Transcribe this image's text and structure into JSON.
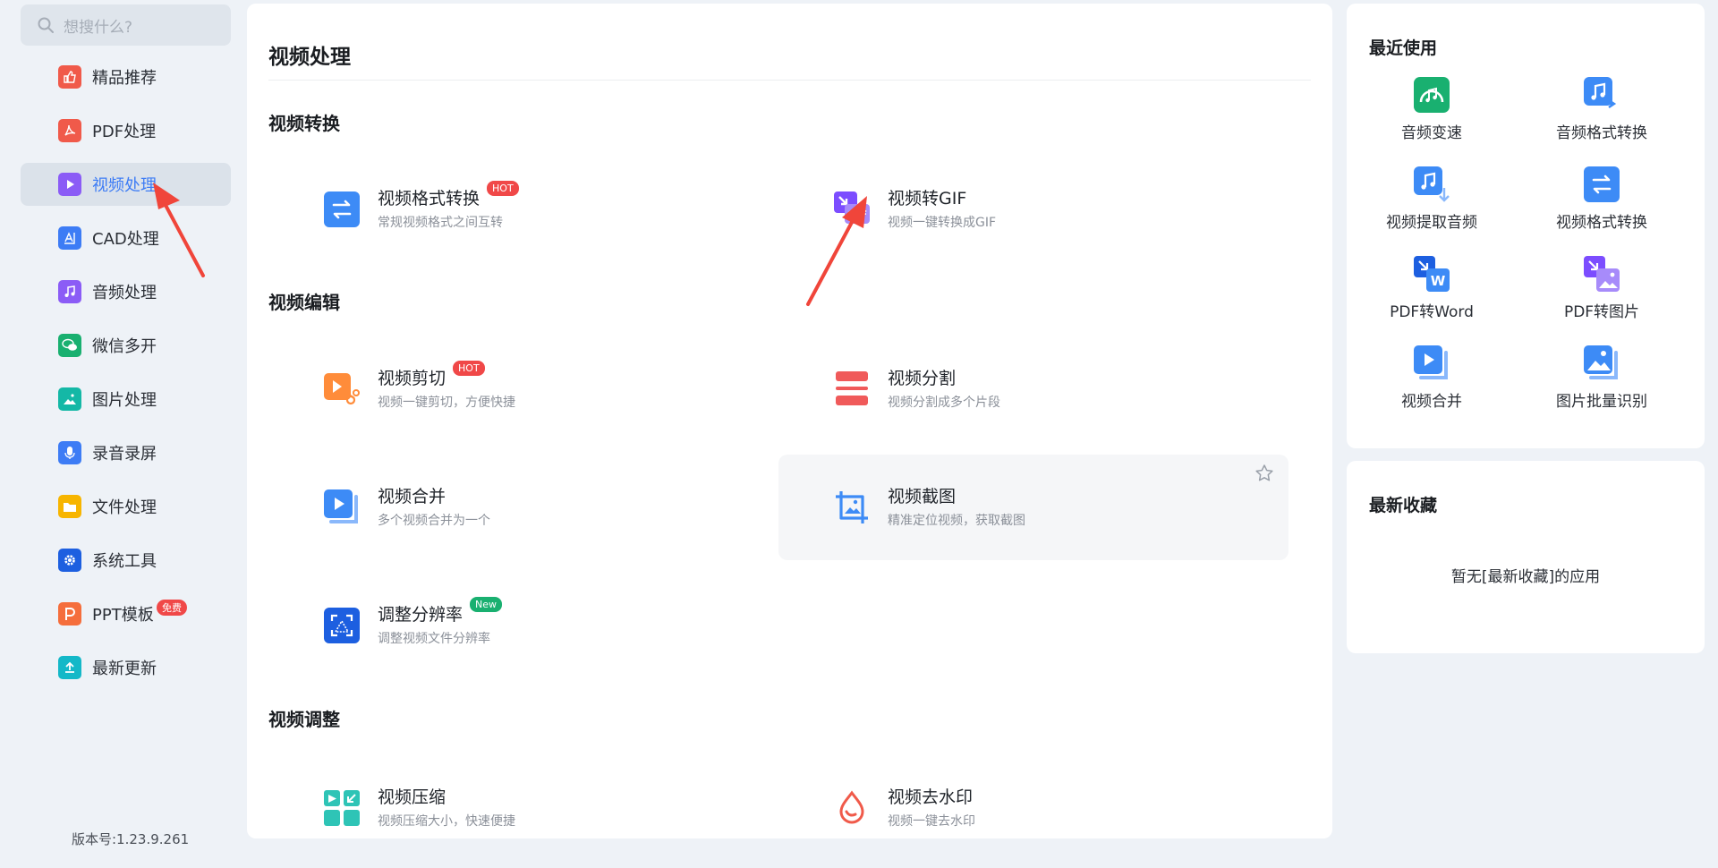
{
  "search": {
    "placeholder": "想搜什么?"
  },
  "sidebar": {
    "items": [
      {
        "label": "精品推荐",
        "icon": "thumbs-up-icon",
        "color": "#f05a4a"
      },
      {
        "label": "PDF处理",
        "icon": "pdf-icon",
        "color": "#f05a4a"
      },
      {
        "label": "视频处理",
        "icon": "video-play-icon",
        "color": "#8b5cf6",
        "active": true
      },
      {
        "label": "CAD处理",
        "icon": "cad-icon",
        "color": "#3d7cf5"
      },
      {
        "label": "音频处理",
        "icon": "music-note-icon",
        "color": "#8b5cf6"
      },
      {
        "label": "微信多开",
        "icon": "wechat-icon",
        "color": "#19b070"
      },
      {
        "label": "图片处理",
        "icon": "image-icon",
        "color": "#14b8a6"
      },
      {
        "label": "录音录屏",
        "icon": "microphone-icon",
        "color": "#3d7cf5"
      },
      {
        "label": "文件处理",
        "icon": "folder-icon",
        "color": "#f7b500"
      },
      {
        "label": "系统工具",
        "icon": "gear-icon",
        "color": "#1d5fe0"
      },
      {
        "label": "PPT模板",
        "icon": "ppt-icon",
        "color": "#f56e3c",
        "badge": "免费"
      },
      {
        "label": "最新更新",
        "icon": "upload-icon",
        "color": "#14b8c8"
      }
    ],
    "version": "版本号:1.23.9.261"
  },
  "main": {
    "title": "视频处理",
    "sections": {
      "convert": "视频转换",
      "edit": "视频编辑",
      "adjust": "视频调整"
    },
    "tools": {
      "format": {
        "name": "视频格式转换",
        "desc": "常规视频格式之间互转",
        "badge": "HOT"
      },
      "gif": {
        "name": "视频转GIF",
        "desc": "视频一键转换成GIF"
      },
      "cut": {
        "name": "视频剪切",
        "desc": "视频一键剪切，方便快捷",
        "badge": "HOT"
      },
      "split": {
        "name": "视频分割",
        "desc": "视频分割成多个片段"
      },
      "merge": {
        "name": "视频合并",
        "desc": "多个视频合并为一个"
      },
      "screenshot": {
        "name": "视频截图",
        "desc": "精准定位视频，获取截图"
      },
      "resolution": {
        "name": "调整分辨率",
        "desc": "调整视频文件分辨率",
        "badge": "New"
      },
      "compress": {
        "name": "视频压缩",
        "desc": "视频压缩大小，快速便捷"
      },
      "watermark": {
        "name": "视频去水印",
        "desc": "视频一键去水印"
      }
    }
  },
  "recent": {
    "title": "最近使用",
    "items": [
      {
        "label": "音频变速",
        "icon": "audio-speed-icon"
      },
      {
        "label": "音频格式转换",
        "icon": "audio-convert-icon"
      },
      {
        "label": "视频提取音频",
        "icon": "extract-audio-icon"
      },
      {
        "label": "视频格式转换",
        "icon": "video-convert-icon"
      },
      {
        "label": "PDF转Word",
        "icon": "pdf-to-word-icon"
      },
      {
        "label": "PDF转图片",
        "icon": "pdf-to-image-icon"
      },
      {
        "label": "视频合并",
        "icon": "video-merge-icon"
      },
      {
        "label": "图片批量识别",
        "icon": "image-ocr-icon"
      }
    ]
  },
  "favorites": {
    "title": "最新收藏",
    "empty_text": "暂无[最新收藏]的应用"
  }
}
